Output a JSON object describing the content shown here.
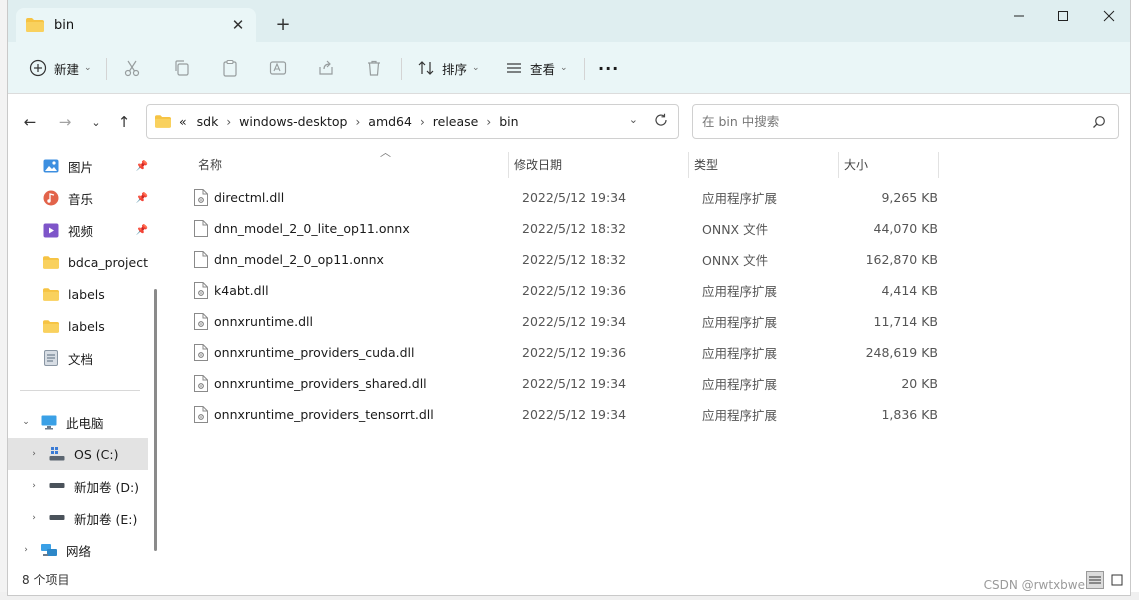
{
  "window": {
    "tab_title": "bin",
    "new_tab_symbol": "+",
    "close_tab_symbol": "✕"
  },
  "toolbar": {
    "new_label": "新建",
    "sort_label": "排序",
    "view_label": "查看",
    "more_label": "···"
  },
  "address": {
    "overflow": "«",
    "crumbs": [
      "sdk",
      "windows-desktop",
      "amd64",
      "release",
      "bin"
    ]
  },
  "search": {
    "placeholder": "在 bin 中搜索"
  },
  "sidebar": {
    "quick_access": [
      {
        "label": "图片",
        "icon": "pictures-icon",
        "pinned": true
      },
      {
        "label": "音乐",
        "icon": "music-icon",
        "pinned": true
      },
      {
        "label": "视频",
        "icon": "videos-icon",
        "pinned": true
      },
      {
        "label": "bdca_project",
        "icon": "folder-icon",
        "pinned": false
      },
      {
        "label": "labels",
        "icon": "folder-icon",
        "pinned": false
      },
      {
        "label": "labels",
        "icon": "folder-icon",
        "pinned": false
      },
      {
        "label": "文档",
        "icon": "documents-icon",
        "pinned": false
      }
    ],
    "this_pc": "此电脑",
    "drives": [
      "OS (C:)",
      "新加卷 (D:)",
      "新加卷 (E:)"
    ],
    "network": "网络"
  },
  "columns": {
    "name": "名称",
    "date": "修改日期",
    "type": "类型",
    "size": "大小"
  },
  "files": [
    {
      "name": "directml.dll",
      "date": "2022/5/12 19:34",
      "type": "应用程序扩展",
      "size": "9,265 KB",
      "kind": "dll"
    },
    {
      "name": "dnn_model_2_0_lite_op11.onnx",
      "date": "2022/5/12 18:32",
      "type": "ONNX 文件",
      "size": "44,070 KB",
      "kind": "file"
    },
    {
      "name": "dnn_model_2_0_op11.onnx",
      "date": "2022/5/12 18:32",
      "type": "ONNX 文件",
      "size": "162,870 KB",
      "kind": "file"
    },
    {
      "name": "k4abt.dll",
      "date": "2022/5/12 19:36",
      "type": "应用程序扩展",
      "size": "4,414 KB",
      "kind": "dll"
    },
    {
      "name": "onnxruntime.dll",
      "date": "2022/5/12 19:34",
      "type": "应用程序扩展",
      "size": "11,714 KB",
      "kind": "dll"
    },
    {
      "name": "onnxruntime_providers_cuda.dll",
      "date": "2022/5/12 19:36",
      "type": "应用程序扩展",
      "size": "248,619 KB",
      "kind": "dll"
    },
    {
      "name": "onnxruntime_providers_shared.dll",
      "date": "2022/5/12 19:34",
      "type": "应用程序扩展",
      "size": "20 KB",
      "kind": "dll"
    },
    {
      "name": "onnxruntime_providers_tensorrt.dll",
      "date": "2022/5/12 19:34",
      "type": "应用程序扩展",
      "size": "1,836 KB",
      "kind": "dll"
    }
  ],
  "status": {
    "item_count": "8 个项目"
  },
  "watermark": "CSDN @rwtxbwe",
  "colors": {
    "titlebar": "#dfeef0",
    "commandbar": "#eaf6f7",
    "folder": "#f6c343",
    "selected": "#e3e3e3"
  }
}
